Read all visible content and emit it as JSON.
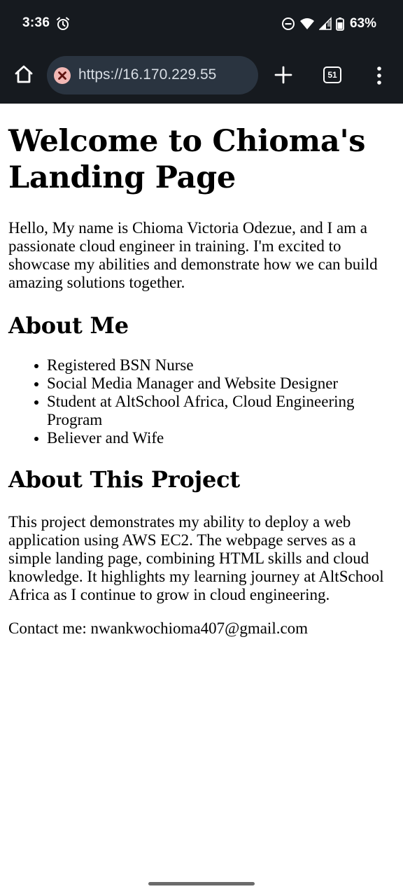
{
  "status_bar": {
    "time": "3:36",
    "battery": "63%",
    "icons": [
      "alarm-icon",
      "dnd-icon",
      "wifi-icon",
      "signal-icon",
      "battery-icon"
    ]
  },
  "browser": {
    "url": "https://16.170.229.55",
    "tab_count": "51",
    "icons": [
      "home-icon",
      "not-secure-icon",
      "plus-icon",
      "tabs-icon",
      "more-vert-icon"
    ],
    "colors": {
      "chrome_bg": "#161a1f",
      "url_pill": "#2a3440",
      "insecure_badge": "#f2b8b5"
    }
  },
  "page": {
    "title": "Welcome to Chioma's Landing Page",
    "intro": "Hello, My name is Chioma Victoria Odezue, and I am a passionate cloud engineer in training. I'm excited to showcase my abilities and demonstrate how we can build amazing solutions together.",
    "about_heading": "About Me",
    "about_items": [
      "Registered BSN Nurse",
      "Social Media Manager and Website Designer",
      "Student at AltSchool Africa, Cloud Engineering Program",
      "Believer and Wife"
    ],
    "project_heading": "About This Project",
    "project_text": "This project demonstrates my ability to deploy a web application using AWS EC2. The webpage serves as a simple landing page, combining HTML skills and cloud knowledge. It highlights my learning journey at AltSchool Africa as I continue to grow in cloud engineering.",
    "contact": "Contact me: nwankwochioma407@gmail.com"
  }
}
